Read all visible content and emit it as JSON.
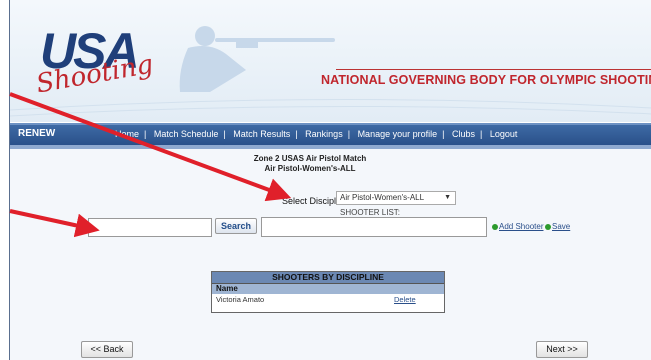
{
  "header": {
    "logo_text": "USA",
    "logo_script": "Shooting",
    "slogan": "NATIONAL GOVERNING BODY FOR OLYMPIC SHOOTING SPORT"
  },
  "nav": {
    "renew": "RENEW",
    "items": [
      "Home",
      "Match Schedule",
      "Match Results",
      "Rankings",
      "Manage your profile",
      "Clubs",
      "Logout"
    ]
  },
  "match": {
    "title_line1": "Zone 2 USAS Air Pistol Match",
    "title_line2": "Air Pistol-Women's-ALL"
  },
  "discipline": {
    "label": "Select Discipline:",
    "selected": "Air Pistol-Women's-ALL"
  },
  "shooter_list": {
    "label": "SHOOTER LIST:",
    "value": ""
  },
  "search": {
    "value": "",
    "button_label": "Search"
  },
  "actions": {
    "add_shooter": "Add Shooter",
    "save": "Save"
  },
  "table": {
    "title": "SHOOTERS BY DISCIPLINE",
    "column": "Name",
    "rows": [
      {
        "name": "Victoria Amato",
        "action": "Delete"
      }
    ]
  },
  "buttons": {
    "back": "<< Back",
    "next": "Next >>"
  },
  "colors": {
    "nav_bg": "#2a5089",
    "slogan": "#c0262d",
    "arrow": "#e0202a",
    "table_header": "#6b88b3"
  }
}
